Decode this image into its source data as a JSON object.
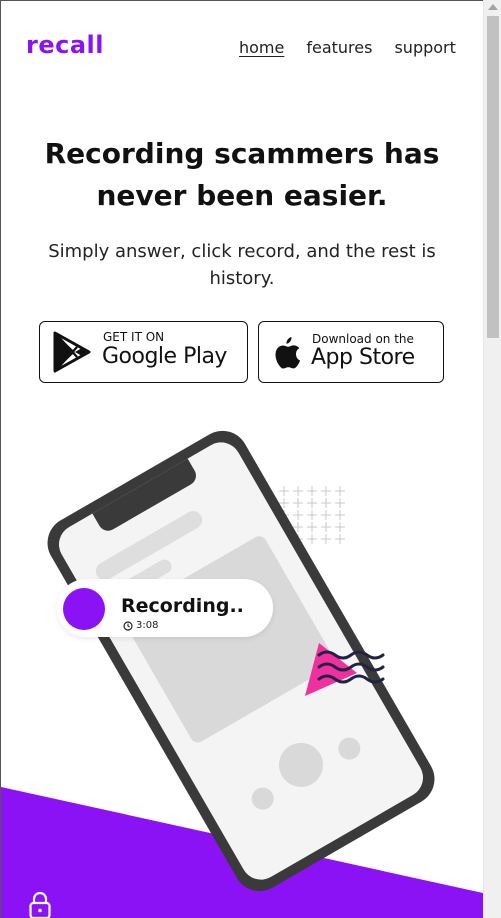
{
  "brand": {
    "logo_text": "recall",
    "accent": "#8b12f5"
  },
  "nav": {
    "items": [
      {
        "label": "home",
        "active": true
      },
      {
        "label": "features",
        "active": false
      },
      {
        "label": "support",
        "active": false
      }
    ]
  },
  "hero": {
    "headline_line1": "Recording scammers has",
    "headline_line2": "never been easier.",
    "subline_line1": "Simply answer, click record, and the rest is",
    "subline_line2": "history."
  },
  "stores": {
    "google": {
      "small": "GET IT ON",
      "big": "Google Play",
      "icon": "google-play-icon"
    },
    "apple": {
      "small": "Download on the",
      "big": "App Store",
      "icon": "apple-icon"
    }
  },
  "recording": {
    "label": "Recording..",
    "time": "3:08",
    "icon": "clock-icon"
  },
  "colors": {
    "purple": "#8b12f5",
    "pink": "#f0309f",
    "navy": "#1f2346",
    "phone_frame": "#3a3a3a",
    "screen_bg": "#f4f4f4",
    "placeholder": "#d9d9d9"
  }
}
